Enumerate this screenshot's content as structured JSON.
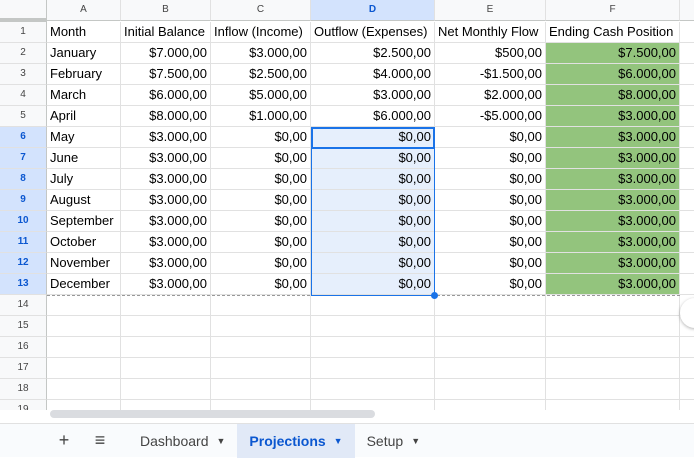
{
  "columns": [
    "A",
    "B",
    "C",
    "D",
    "E",
    "F"
  ],
  "selected_column": "D",
  "rows": [
    [
      "Month",
      "Initial Balance",
      "Inflow (Income)",
      "Outflow (Expenses)",
      "Net Monthly Flow",
      "Ending Cash Position"
    ],
    [
      "January",
      "$7.000,00",
      "$3.000,00",
      "$2.500,00",
      "$500,00",
      "$7.500,00"
    ],
    [
      "February",
      "$7.500,00",
      "$2.500,00",
      "$4.000,00",
      "-$1.500,00",
      "$6.000,00"
    ],
    [
      "March",
      "$6.000,00",
      "$5.000,00",
      "$3.000,00",
      "$2.000,00",
      "$8.000,00"
    ],
    [
      "April",
      "$8.000,00",
      "$1.000,00",
      "$6.000,00",
      "-$5.000,00",
      "$3.000,00"
    ],
    [
      "May",
      "$3.000,00",
      "$0,00",
      "$0,00",
      "$0,00",
      "$3.000,00"
    ],
    [
      "June",
      "$3.000,00",
      "$0,00",
      "$0,00",
      "$0,00",
      "$3.000,00"
    ],
    [
      "July",
      "$3.000,00",
      "$0,00",
      "$0,00",
      "$0,00",
      "$3.000,00"
    ],
    [
      "August",
      "$3.000,00",
      "$0,00",
      "$0,00",
      "$0,00",
      "$3.000,00"
    ],
    [
      "September",
      "$3.000,00",
      "$0,00",
      "$0,00",
      "$0,00",
      "$3.000,00"
    ],
    [
      "October",
      "$3.000,00",
      "$0,00",
      "$0,00",
      "$0,00",
      "$3.000,00"
    ],
    [
      "November",
      "$3.000,00",
      "$0,00",
      "$0,00",
      "$0,00",
      "$3.000,00"
    ],
    [
      "December",
      "$3.000,00",
      "$0,00",
      "$0,00",
      "$0,00",
      "$3.000,00"
    ]
  ],
  "row_numbers": [
    "1",
    "2",
    "3",
    "4",
    "5",
    "6",
    "7",
    "8",
    "9",
    "10",
    "11",
    "12",
    "13",
    "14",
    "15",
    "16",
    "17",
    "18",
    "19"
  ],
  "colors": {
    "highlight": "#93c47d",
    "accent": "#1a73e8"
  },
  "tabs": {
    "add": "+",
    "menu": "≡",
    "sheets": [
      {
        "label": "Dashboard"
      },
      {
        "label": "Projections",
        "active": true
      },
      {
        "label": "Setup"
      }
    ]
  }
}
